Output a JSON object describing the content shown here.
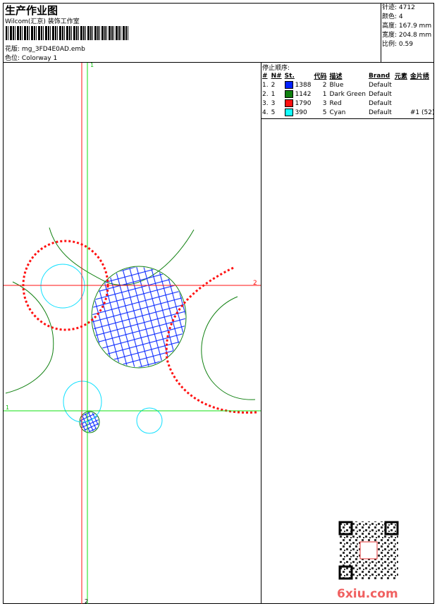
{
  "header": {
    "title": "生产作业图",
    "studio": "Wilcom(汇京) 装饰工作室",
    "design_label": "花版:",
    "design_file": "mg_3FD4E0AD.emb",
    "colorway_label": "色位:",
    "colorway": "Colorway 1"
  },
  "stats": [
    {
      "label": "针迹:",
      "value": "4712"
    },
    {
      "label": "颜色:",
      "value": "4"
    },
    {
      "label": "高度:",
      "value": "167.9 mm"
    },
    {
      "label": "宽度:",
      "value": "204.8 mm"
    },
    {
      "label": "比例:",
      "value": "0.59"
    }
  ],
  "stop_sequence": {
    "title": "停止顺序:",
    "columns": [
      "#",
      "N#",
      "St.",
      "代码",
      "描述",
      "Brand",
      "元素",
      "金片绣"
    ],
    "rows": [
      {
        "idx": "1.",
        "n": "2",
        "color": "#0020ff",
        "st": "1388",
        "code": "2",
        "desc": "Blue",
        "brand": "Default",
        "elem": "",
        "seq": ""
      },
      {
        "idx": "2.",
        "n": "1",
        "color": "#108010",
        "st": "1142",
        "code": "1",
        "desc": "Dark Green",
        "brand": "Default",
        "elem": "",
        "seq": ""
      },
      {
        "idx": "3.",
        "n": "3",
        "color": "#ff1010",
        "st": "1790",
        "code": "3",
        "desc": "Red",
        "brand": "Default",
        "elem": "",
        "seq": ""
      },
      {
        "idx": "4.",
        "n": "5",
        "color": "#10ffff",
        "st": "390",
        "code": "5",
        "desc": "Cyan",
        "brand": "Default",
        "elem": "",
        "seq": "#1 (52)"
      }
    ]
  },
  "guides": {
    "v1": "1",
    "v2": "2",
    "h1": "1",
    "h2": "2"
  },
  "watermark": {
    "text": "6xiu.com"
  }
}
